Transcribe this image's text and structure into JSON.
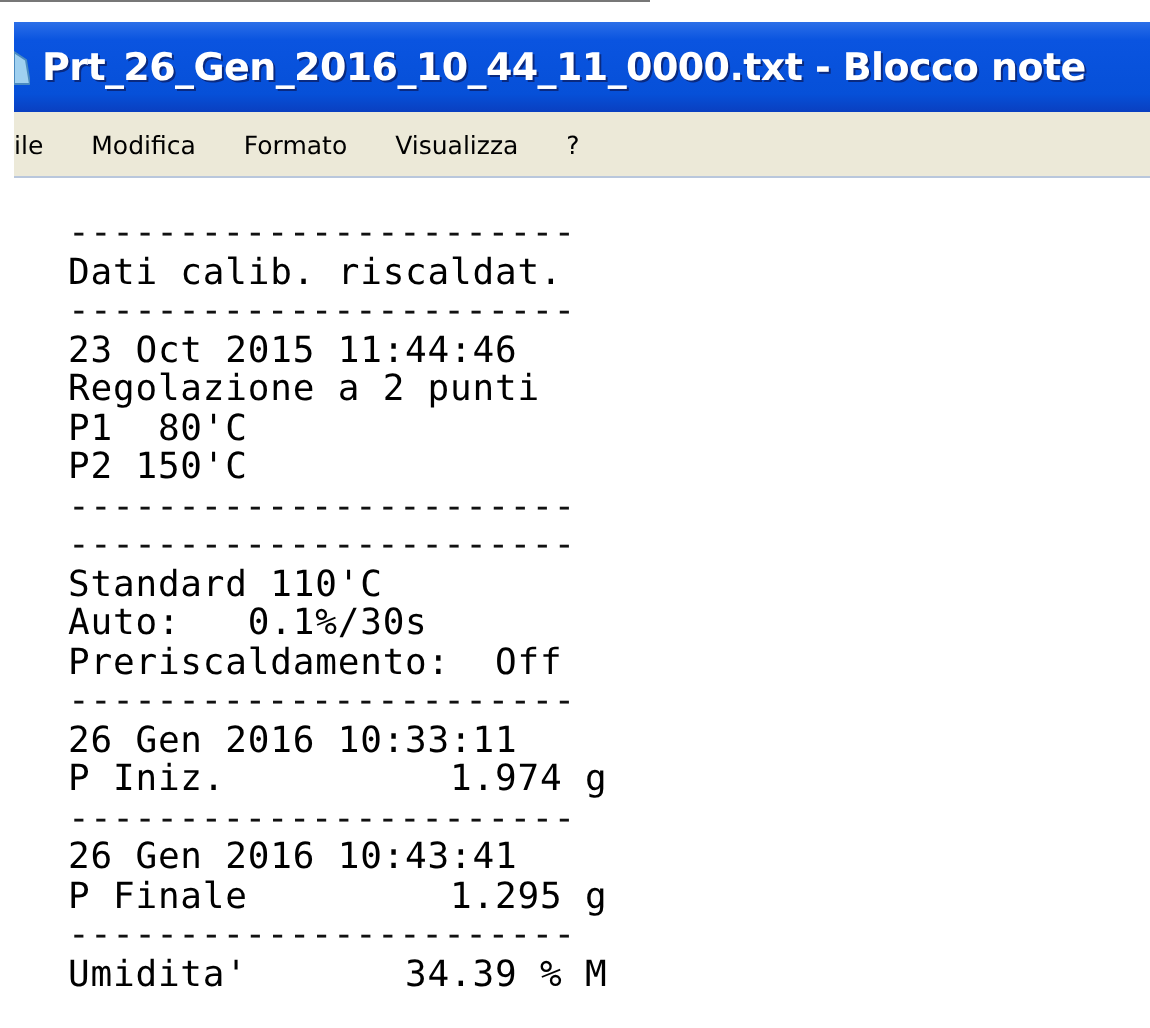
{
  "window": {
    "title": "Prt_26_Gen_2016_10_44_11_0000.txt - Blocco note"
  },
  "menu": [
    "ile",
    "Modifica",
    "Formato",
    "Visualizza",
    "?"
  ],
  "document": {
    "lines": [
      {
        "kind": "rule",
        "text": "-----------------------"
      },
      {
        "kind": "text",
        "text": "Dati calib. riscaldat."
      },
      {
        "kind": "rule",
        "text": "-----------------------"
      },
      {
        "kind": "text",
        "text": "23 Oct 2015 11:44:46"
      },
      {
        "kind": "text",
        "text": "Regolazione a 2 punti"
      },
      {
        "kind": "text",
        "text": "P1  80'C"
      },
      {
        "kind": "text",
        "text": "P2 150'C"
      },
      {
        "kind": "rule",
        "text": "-----------------------"
      },
      {
        "kind": "rule",
        "text": "-----------------------"
      },
      {
        "kind": "text",
        "text": "Standard 110'C"
      },
      {
        "kind": "text",
        "text": "Auto:   0.1%/30s"
      },
      {
        "kind": "text",
        "text": "Preriscaldamento:  Off"
      },
      {
        "kind": "rule",
        "text": "-----------------------"
      },
      {
        "kind": "text",
        "text": "26 Gen 2016 10:33:11"
      },
      {
        "kind": "text",
        "text": "P Iniz.          1.974 g"
      },
      {
        "kind": "rule",
        "text": "-----------------------"
      },
      {
        "kind": "text",
        "text": "26 Gen 2016 10:43:41"
      },
      {
        "kind": "text",
        "text": "P Finale         1.295 g"
      },
      {
        "kind": "rule",
        "text": "-----------------------"
      },
      {
        "kind": "text",
        "text": "Umidita'       34.39 % M"
      }
    ]
  }
}
